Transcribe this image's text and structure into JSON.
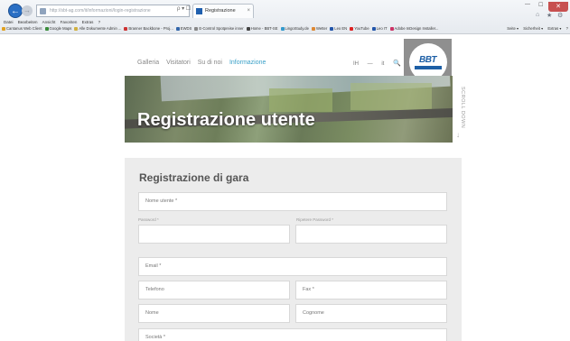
{
  "browser": {
    "address": "http://sbt-ag.com/it/informazioni/login-registrazione",
    "address_tools": "ρ ▾ ☐ ✕",
    "tab_title": "Registrazione",
    "tab_close": "×",
    "window_controls": {
      "minimize": "—",
      "maximize": "☐",
      "close": "✕"
    },
    "back_glyph": "←",
    "forward_glyph": "→",
    "ie_icons": {
      "home": "⌂",
      "favorites": "★",
      "tools": "⚙"
    },
    "menu": [
      "Datei",
      "Bearbeiten",
      "Ansicht",
      "Favoriten",
      "Extras",
      "?"
    ],
    "favorites": [
      {
        "label": "Cantanus Web Client",
        "color": "#e0a020"
      },
      {
        "label": "Google Maps",
        "color": "#3c8d3c"
      },
      {
        "label": "Alle Dokumente Admin ...",
        "color": "#d0b040"
      },
      {
        "label": "Branner Backbone - Proj...",
        "color": "#cc3333"
      },
      {
        "label": "EWDS",
        "color": "#3366aa"
      },
      {
        "label": "E-Control Spotpreise inner",
        "color": "#888888"
      },
      {
        "label": "Home - BBT-SE",
        "color": "#444444"
      },
      {
        "label": "LingoStudy.de",
        "color": "#3399cc"
      },
      {
        "label": "Wetter",
        "color": "#dd8833"
      },
      {
        "label": "Leo EN",
        "color": "#2255aa"
      },
      {
        "label": "YouTube",
        "color": "#dd2222"
      },
      {
        "label": "Leo IT",
        "color": "#2255aa"
      },
      {
        "label": "Adobe InDesign Installer...",
        "color": "#cc3366"
      }
    ],
    "toolbar_right": [
      "Seite ▾",
      "Sicherheit ▾",
      "Extras ▾",
      "?"
    ]
  },
  "site": {
    "nav": [
      {
        "label": "Galleria",
        "active": false
      },
      {
        "label": "Visitatori",
        "active": false
      },
      {
        "label": "Su di noi",
        "active": false
      },
      {
        "label": "Informazione",
        "active": true
      }
    ],
    "header_icons": {
      "language": "IH",
      "sep": "—",
      "mode": "it",
      "search": "🔍"
    },
    "logo_text": "BBT",
    "hero_title": "Registrazione utente",
    "scroll_label": "SCROLL DOWN",
    "scroll_arrow": "↓"
  },
  "form": {
    "title": "Registrazione di gara",
    "username_placeholder": "Nome utente *",
    "password_label": "Password *",
    "password_repeat_label": "Ripetere Password *",
    "email_placeholder": "Email *",
    "phone_placeholder": "Telefono",
    "fax_placeholder": "Fax *",
    "first_name_placeholder": "Nome",
    "last_name_placeholder": "Cognome",
    "company_placeholder": "Società *"
  },
  "colors": {
    "accent": "#3aa0c8",
    "logo_blue": "#1d5fa6",
    "panel_bg": "#ececec"
  }
}
